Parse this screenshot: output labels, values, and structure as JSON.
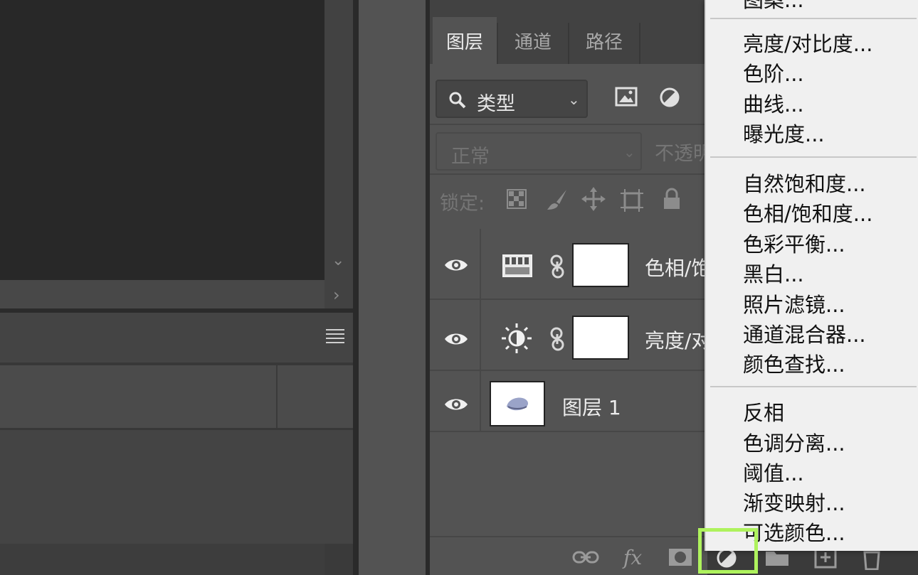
{
  "layers_panel": {
    "tabs": [
      {
        "label": "图层",
        "active": true
      },
      {
        "label": "通道",
        "active": false
      },
      {
        "label": "路径",
        "active": false
      }
    ],
    "filter": {
      "label": "类型"
    },
    "blend_mode": "正常",
    "opacity_label": "不透明",
    "lock_label": "锁定:",
    "layers": [
      {
        "name": "色相/饱",
        "type": "hue-saturation"
      },
      {
        "name": "亮度/对",
        "type": "brightness-contrast"
      },
      {
        "name": "图层 1",
        "type": "pixel"
      }
    ]
  },
  "adjustment_menu": {
    "groups": [
      [
        "亮度/对比度...",
        "色阶...",
        "曲线...",
        "曝光度..."
      ],
      [
        "自然饱和度...",
        "色相/饱和度...",
        "色彩平衡...",
        "黑白...",
        "照片滤镜...",
        "通道混合器...",
        "颜色查找..."
      ],
      [
        "反相",
        "色调分离...",
        "阈值...",
        "渐变映射...",
        "可选颜色..."
      ]
    ]
  },
  "colors": {
    "highlight": "#aef25d",
    "panel_bg": "#535353",
    "menu_bg": "#f0f0f0"
  }
}
